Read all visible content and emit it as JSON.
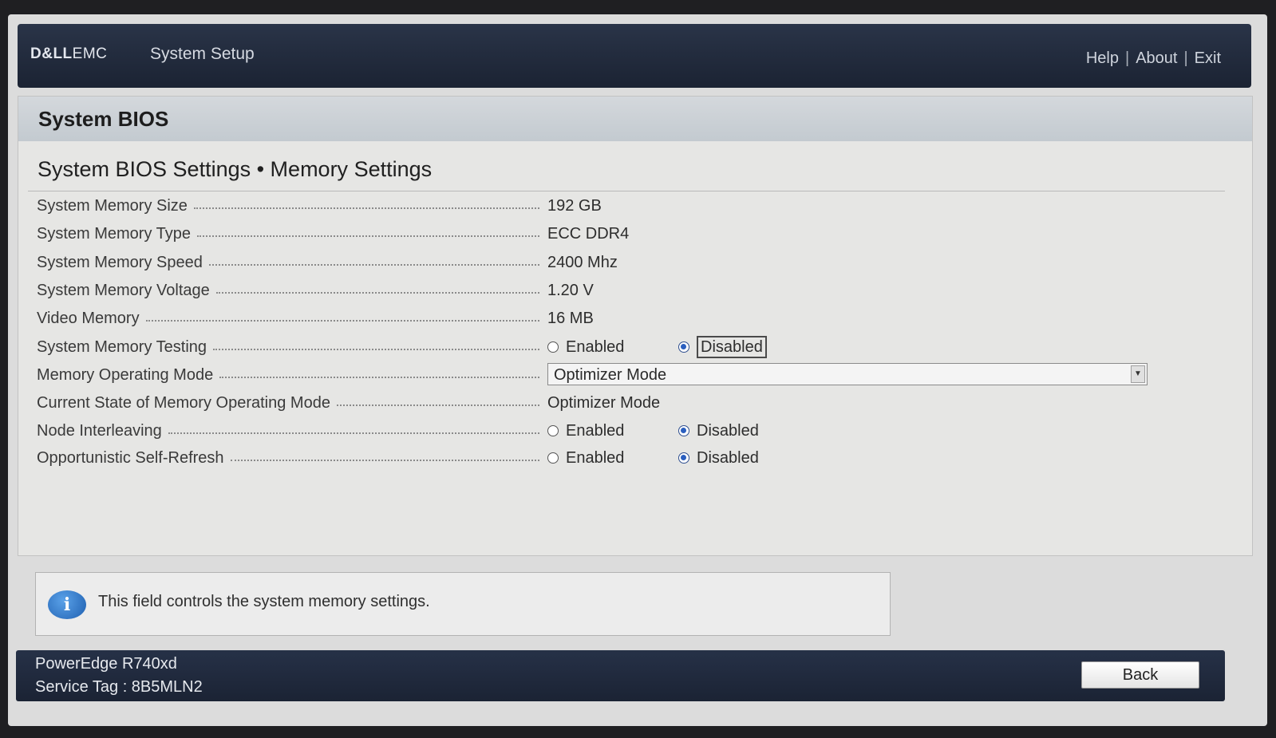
{
  "header": {
    "logo_dell": "D&LL",
    "logo_emc": "EMC",
    "title": "System Setup",
    "links": [
      "Help",
      "About",
      "Exit"
    ],
    "separator": "|"
  },
  "panel": {
    "title": "System BIOS",
    "breadcrumb": "System BIOS Settings • Memory Settings"
  },
  "settings": [
    {
      "label": "System Memory Size",
      "type": "text",
      "value": "192 GB"
    },
    {
      "label": "System Memory Type",
      "type": "text",
      "value": "ECC DDR4"
    },
    {
      "label": "System Memory Speed",
      "type": "text",
      "value": "2400 Mhz"
    },
    {
      "label": "System Memory Voltage",
      "type": "text",
      "value": "1.20 V"
    },
    {
      "label": "Video Memory",
      "type": "text",
      "value": "16 MB"
    },
    {
      "label": "System Memory Testing",
      "type": "radio",
      "options": [
        "Enabled",
        "Disabled"
      ],
      "selected": "Disabled",
      "focused": true
    },
    {
      "label": "Memory Operating Mode",
      "type": "select",
      "value": "Optimizer Mode"
    },
    {
      "label": "Current State of Memory Operating Mode",
      "type": "text",
      "value": "Optimizer Mode"
    },
    {
      "label": "Node Interleaving",
      "type": "radio",
      "options": [
        "Enabled",
        "Disabled"
      ],
      "selected": "Disabled"
    },
    {
      "label": "Opportunistic Self-Refresh",
      "type": "radio",
      "options": [
        "Enabled",
        "Disabled"
      ],
      "selected": "Disabled"
    }
  ],
  "info": {
    "icon": "info-icon",
    "text": "This field controls the system memory settings."
  },
  "footer": {
    "model": "PowerEdge R740xd",
    "service_tag": "Service Tag : 8B5MLN2",
    "back_label": "Back"
  },
  "colors": {
    "header_bg": "#1f2838",
    "radio_selected": "#2b5fbf",
    "info_icon": "#2a6fc0"
  }
}
